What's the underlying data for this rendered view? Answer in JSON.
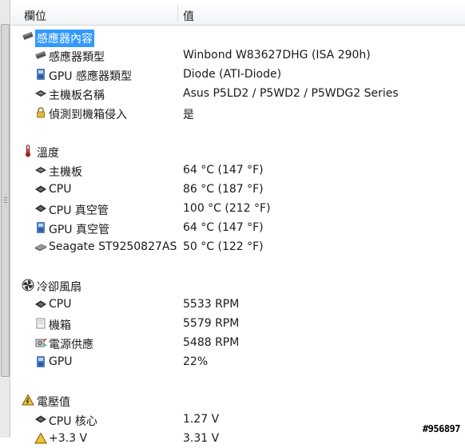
{
  "header": {
    "col_field": "欄位",
    "col_value": "值"
  },
  "sections": {
    "sensor": {
      "title": "感應器內容",
      "rows": [
        {
          "label": "感應器類型",
          "value": "Winbond W83627DHG  (ISA 290h)"
        },
        {
          "label": "GPU 感應器類型",
          "value": "Diode  (ATI-Diode)"
        },
        {
          "label": "主機板名稱",
          "value": "Asus P5LD2 / P5WD2 / P5WDG2 Series"
        },
        {
          "label": "偵測到機箱侵入",
          "value": "是"
        }
      ]
    },
    "temp": {
      "title": "溫度",
      "rows": [
        {
          "label": "主機板",
          "value": "64 °C  (147 °F)"
        },
        {
          "label": "CPU",
          "value": "86 °C  (187 °F)"
        },
        {
          "label": "CPU 真空管",
          "value": "100 °C  (212 °F)"
        },
        {
          "label": "GPU 真空管",
          "value": "64 °C  (147 °F)"
        },
        {
          "label": "Seagate ST9250827AS",
          "value": "50 °C  (122 °F)"
        }
      ]
    },
    "fan": {
      "title": "冷卻風扇",
      "rows": [
        {
          "label": "CPU",
          "value": "5533 RPM"
        },
        {
          "label": "機箱",
          "value": "5579 RPM"
        },
        {
          "label": "電源供應",
          "value": "5488 RPM"
        },
        {
          "label": "GPU",
          "value": "22%"
        }
      ]
    },
    "volt": {
      "title": "電壓值",
      "rows": [
        {
          "label": "CPU 核心",
          "value": "1.27 V"
        },
        {
          "label": "+3.3 V",
          "value": "3.31 V"
        }
      ]
    }
  },
  "watermark": "#956897",
  "colors": {
    "selection": "#3399ff",
    "header_bg": "#f1f3f6"
  }
}
